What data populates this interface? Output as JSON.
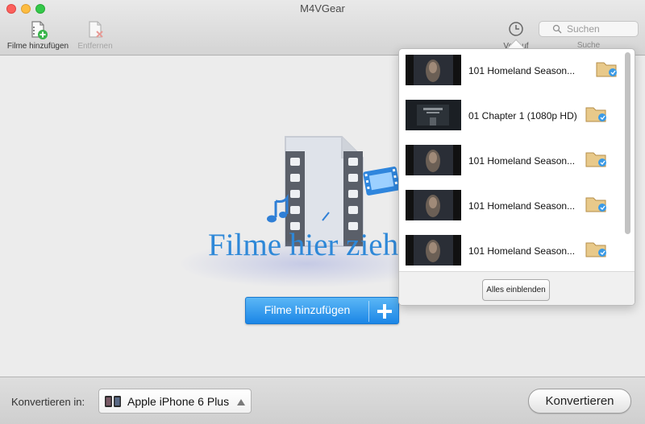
{
  "window": {
    "title": "M4VGear"
  },
  "toolbar": {
    "add_label": "Filme hinzufügen",
    "remove_label": "Entfernen",
    "history_label": "Verlauf",
    "search_placeholder": "Suchen",
    "search_label": "Suche",
    "add_icon": "add-file-icon",
    "remove_icon": "remove-file-icon",
    "history_icon": "clock-icon",
    "search_icon": "magnifier-icon"
  },
  "main": {
    "drop_text": "Filme hier ziehen",
    "add_button_label": "Filme hinzufügen",
    "add_button_icon": "plus-icon",
    "accent_color": "#2e88d8"
  },
  "history": {
    "items": [
      {
        "title": "101 Homeland Season...",
        "thumb_icon": "video-thumbnail",
        "action_icon": "folder-icon"
      },
      {
        "title": "01 Chapter 1 (1080p HD)",
        "thumb_icon": "video-thumbnail",
        "action_icon": "folder-icon"
      },
      {
        "title": "101 Homeland Season...",
        "thumb_icon": "video-thumbnail",
        "action_icon": "folder-icon"
      },
      {
        "title": "101 Homeland Season...",
        "thumb_icon": "video-thumbnail",
        "action_icon": "folder-icon"
      },
      {
        "title": "101 Homeland Season...",
        "thumb_icon": "video-thumbnail",
        "action_icon": "folder-icon"
      }
    ],
    "show_all_label": "Alles einblenden"
  },
  "bottom": {
    "convert_to_label": "Konvertieren in:",
    "device_value": "Apple iPhone 6 Plus",
    "device_icon": "iphone-icon",
    "convert_button_label": "Konvertieren"
  }
}
